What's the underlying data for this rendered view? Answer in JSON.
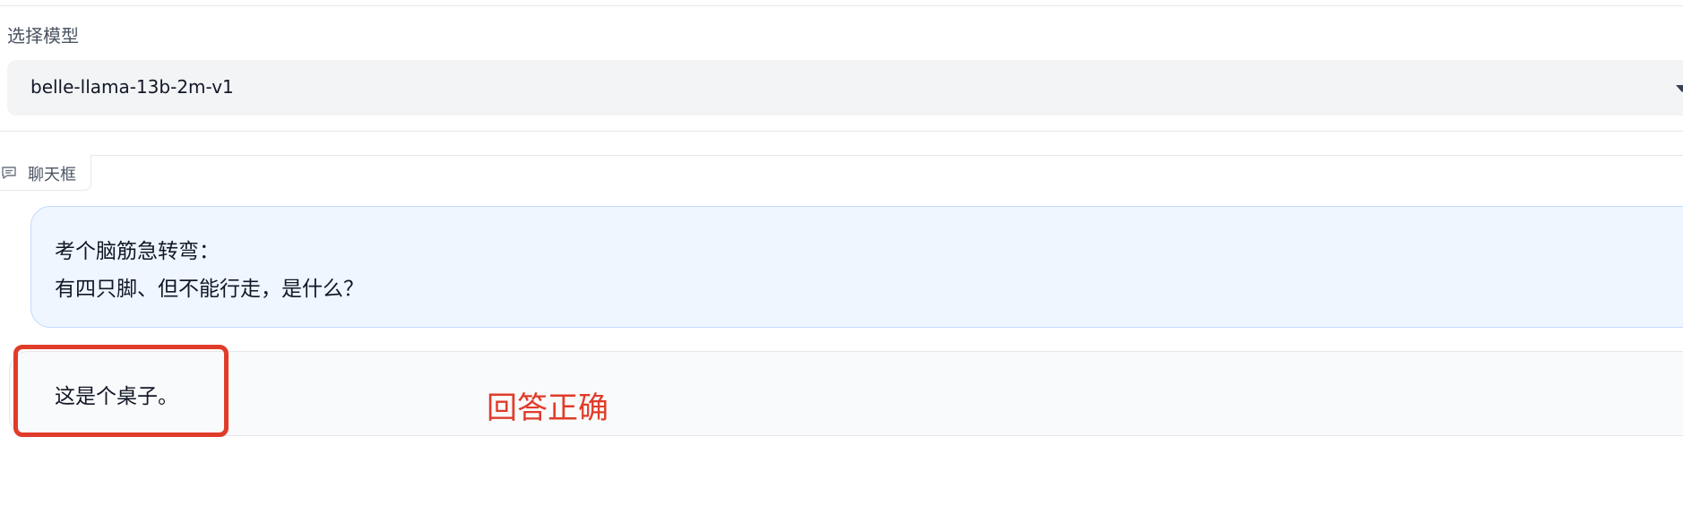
{
  "model_selector": {
    "label": "选择模型",
    "selected": "belle-llama-13b-2m-v1"
  },
  "chat": {
    "tab_label": "聊天框",
    "tab_icon": "chat-icon",
    "messages": [
      {
        "role": "user",
        "lines": [
          "考个脑筋急转弯：",
          "有四只脚、但不能行走，是什么？"
        ]
      },
      {
        "role": "bot",
        "text": "这是个桌子。"
      }
    ]
  },
  "annotation": {
    "text": "回答正确",
    "color": "#e03c2a"
  },
  "colors": {
    "user_bubble_bg": "#eff6ff",
    "user_bubble_border": "#bfdbfe",
    "bot_bubble_bg": "#f9fafb",
    "highlight": "#e03c2a"
  }
}
